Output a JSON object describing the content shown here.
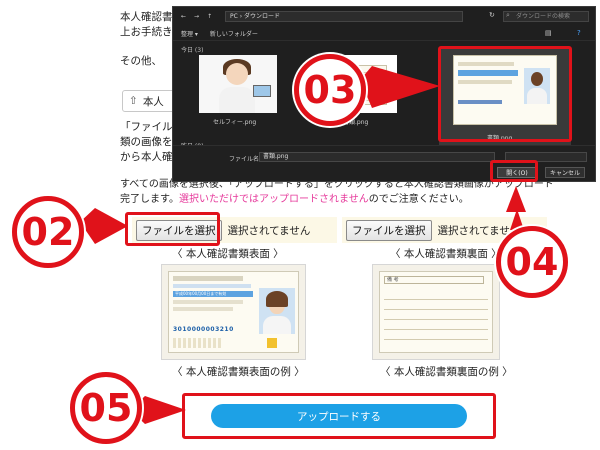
{
  "page": {
    "intro_line1": "本人確認書",
    "intro_line2": "上お手続き",
    "intro_line3": "その他、",
    "upload_chip_label": "本人",
    "file_line1": "「ファイル",
    "file_line2": "類の画像を",
    "file_line3": "から本人確",
    "notice_line1": "すべての画像を選択後、「アップロードする」をクリックすると本人確認書類画像がアップロード",
    "notice_line2_a": "完了します。",
    "notice_line2_b": "選択いただけではアップロードされません",
    "notice_line2_c": "のでご注意ください。",
    "file_button_label": "ファイルを選択",
    "file_status": "選択されてません",
    "front_caption": "〈 本人確認書類表面 〉",
    "back_caption": "〈 本人確認書類裏面 〉",
    "front_example_caption": "〈 本人確認書類表面の例 〉",
    "back_example_caption": "〈 本人確認書類裏面の例 〉",
    "submit_label": "アップロードする"
  },
  "badges": [
    "02",
    "03",
    "04",
    "05"
  ],
  "dialog": {
    "path": "PC › ダウンロード",
    "search_placeholder": "ダウンロードの検索",
    "toolbar_organize": "整理 ▾",
    "toolbar_new_folder": "新しいフォルダー",
    "group_today": "今日 (3)",
    "group_yesterday": "昨日 (8)",
    "files": [
      {
        "name": "セルフィー.png"
      },
      {
        "name": "書類.png"
      },
      {
        "name": "書類.png"
      }
    ],
    "filename_label": "ファイル名(N):",
    "filename_value": "書類.png",
    "open_label": "開く(O)",
    "cancel_label": "キャンセル"
  },
  "card": {
    "serial": "3010000003210",
    "banner": "平成00年00月00日まで有効",
    "back_label": "備 考"
  },
  "colors": {
    "accent_red": "#e0121a",
    "submit_blue": "#1da1e6",
    "notice_pink": "#e6399b",
    "dialog_bg": "#1f1f1f"
  }
}
